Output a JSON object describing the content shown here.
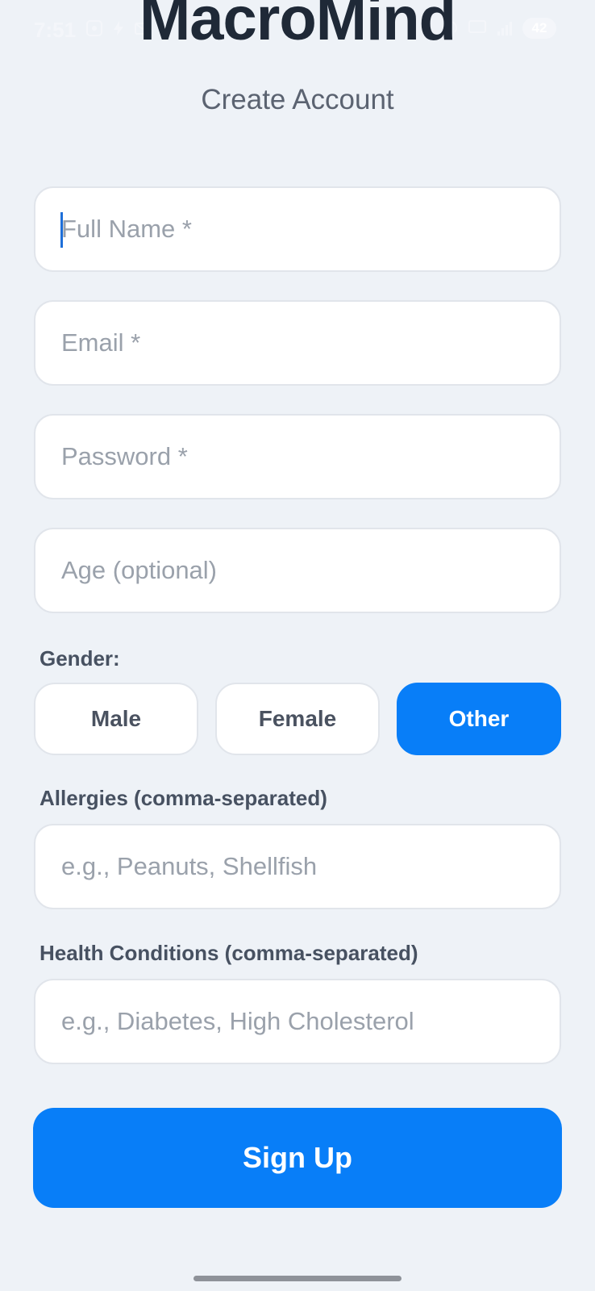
{
  "status_bar": {
    "time": "7:51",
    "battery": "42",
    "left_icons": [
      "screen-record-icon",
      "bolt-icon",
      "mail-icon",
      "dot-icon"
    ],
    "right_icons": [
      "hotspot-icon",
      "5g-icon",
      "signal-icon"
    ]
  },
  "header": {
    "title": "MacroMind",
    "subtitle": "Create Account"
  },
  "form": {
    "full_name": {
      "placeholder": "Full Name *",
      "value": ""
    },
    "email": {
      "placeholder": "Email *",
      "value": ""
    },
    "password": {
      "placeholder": "Password *",
      "value": ""
    },
    "age": {
      "placeholder": "Age (optional)",
      "value": ""
    },
    "gender": {
      "label": "Gender:",
      "options": [
        "Male",
        "Female",
        "Other"
      ],
      "selected": "Other"
    },
    "allergies": {
      "label": "Allergies (comma-separated)",
      "placeholder": "e.g., Peanuts, Shellfish",
      "value": ""
    },
    "health_conditions": {
      "label": "Health Conditions (comma-separated)",
      "placeholder": "e.g., Diabetes, High Cholesterol",
      "value": ""
    },
    "submit_label": "Sign Up"
  },
  "colors": {
    "background": "#eef2f7",
    "accent": "#087ef8",
    "title": "#1f2937"
  }
}
